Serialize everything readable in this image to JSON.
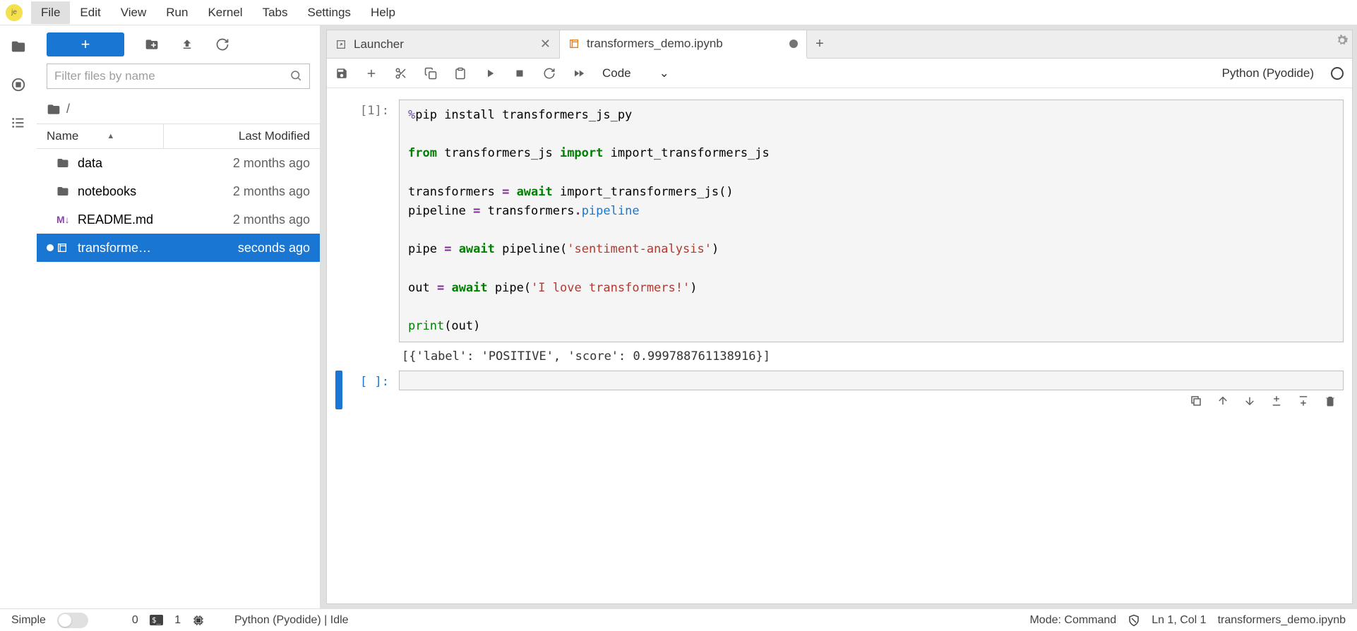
{
  "menus": [
    "File",
    "Edit",
    "View",
    "Run",
    "Kernel",
    "Tabs",
    "Settings",
    "Help"
  ],
  "file_panel": {
    "filter_placeholder": "Filter files by name",
    "breadcrumb": "/",
    "headers": {
      "name": "Name",
      "modified": "Last Modified"
    },
    "files": [
      {
        "icon": "folder",
        "name": "data",
        "modified": "2 months ago",
        "selected": false
      },
      {
        "icon": "folder",
        "name": "notebooks",
        "modified": "2 months ago",
        "selected": false
      },
      {
        "icon": "markdown",
        "name": "README.md",
        "modified": "2 months ago",
        "selected": false
      },
      {
        "icon": "notebook",
        "name": "transforme…",
        "modified": "seconds ago",
        "selected": true
      }
    ]
  },
  "tabs": [
    {
      "icon": "launcher",
      "label": "Launcher",
      "active": false,
      "dirty": false
    },
    {
      "icon": "notebook",
      "label": "transformers_demo.ipynb",
      "active": true,
      "dirty": true
    }
  ],
  "toolbar": {
    "cell_type": "Code",
    "kernel": "Python (Pyodide)"
  },
  "cells": [
    {
      "prompt": "[1]:",
      "output": "[{'label': 'POSITIVE', 'score': 0.999788761138916}]"
    },
    {
      "prompt": "[ ]:"
    }
  ],
  "code": {
    "line1_a": "%",
    "line1_b": "pip install transformers_js_py",
    "line2_a": "from",
    "line2_b": " transformers_js ",
    "line2_c": "import",
    "line2_d": " import_transformers_js",
    "line3_a": "transformers ",
    "line3_b": "=",
    "line3_c": " ",
    "line3_d": "await",
    "line3_e": " import_transformers_js()",
    "line4_a": "pipeline ",
    "line4_b": "=",
    "line4_c": " transformers",
    "line4_d": ".",
    "line4_e": "pipeline",
    "line5_a": "pipe ",
    "line5_b": "=",
    "line5_c": " ",
    "line5_d": "await",
    "line5_e": " pipeline(",
    "line5_f": "'sentiment-analysis'",
    "line5_g": ")",
    "line6_a": "out ",
    "line6_b": "=",
    "line6_c": " ",
    "line6_d": "await",
    "line6_e": " pipe(",
    "line6_f": "'I love transformers!'",
    "line6_g": ")",
    "line7_a": "print",
    "line7_b": "(out)"
  },
  "statusbar": {
    "simple": "Simple",
    "tabs_count": "0",
    "terminals_count": "1",
    "kernel_status": "Python (Pyodide) | Idle",
    "mode": "Mode: Command",
    "position": "Ln 1, Col 1",
    "filename": "transformers_demo.ipynb"
  }
}
